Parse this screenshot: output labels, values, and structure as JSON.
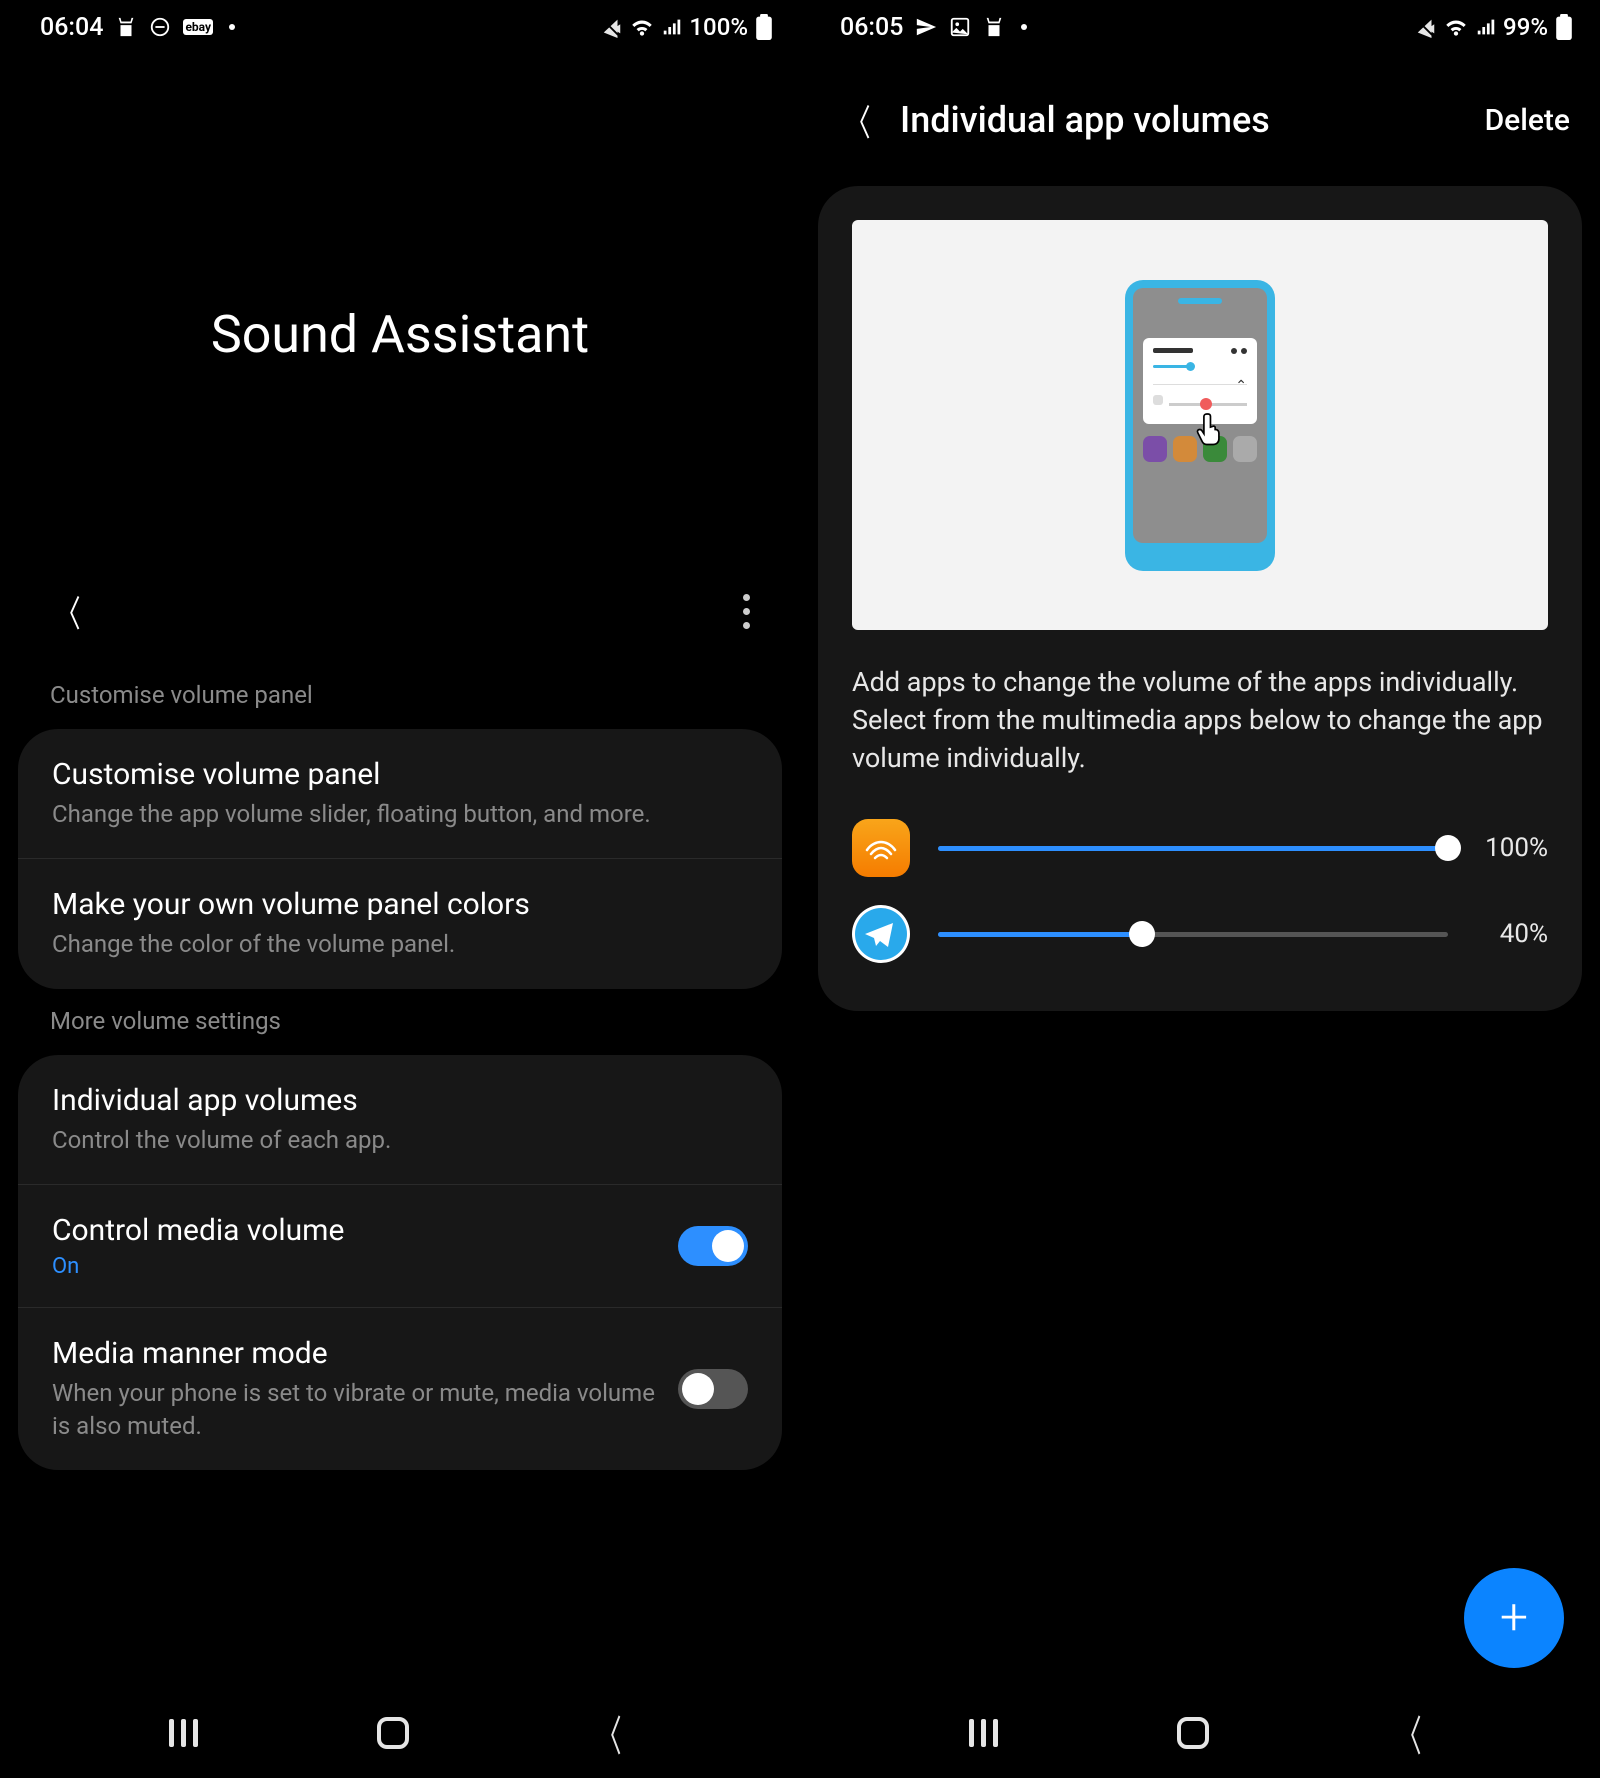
{
  "screen1": {
    "status": {
      "time": "06:04",
      "battery_text": "100%"
    },
    "title": "Sound Assistant",
    "section1_header": "Customise volume panel",
    "items1": [
      {
        "title": "Customise volume panel",
        "subtitle": "Change the app volume slider, floating button, and more."
      },
      {
        "title": "Make your own volume panel colors",
        "subtitle": "Change the color of the volume panel."
      }
    ],
    "section2_header": "More volume settings",
    "items2": [
      {
        "title": "Individual app volumes",
        "subtitle": "Control the volume of each app."
      },
      {
        "title": "Control media volume",
        "on_label": "On",
        "toggle": true
      },
      {
        "title": "Media manner mode",
        "subtitle": "When your phone is set to vibrate or mute, media volume is also muted.",
        "toggle": false
      }
    ]
  },
  "screen2": {
    "status": {
      "time": "06:05",
      "battery_text": "99%"
    },
    "header_title": "Individual app volumes",
    "delete_label": "Delete",
    "description": "Add apps to change the volume of the apps individually. Select from the multimedia apps below to change the app volume individually.",
    "apps": [
      {
        "name": "audible",
        "value": 100,
        "label": "100%"
      },
      {
        "name": "telegram",
        "value": 40,
        "label": "40%"
      }
    ],
    "fab_label": "+"
  }
}
